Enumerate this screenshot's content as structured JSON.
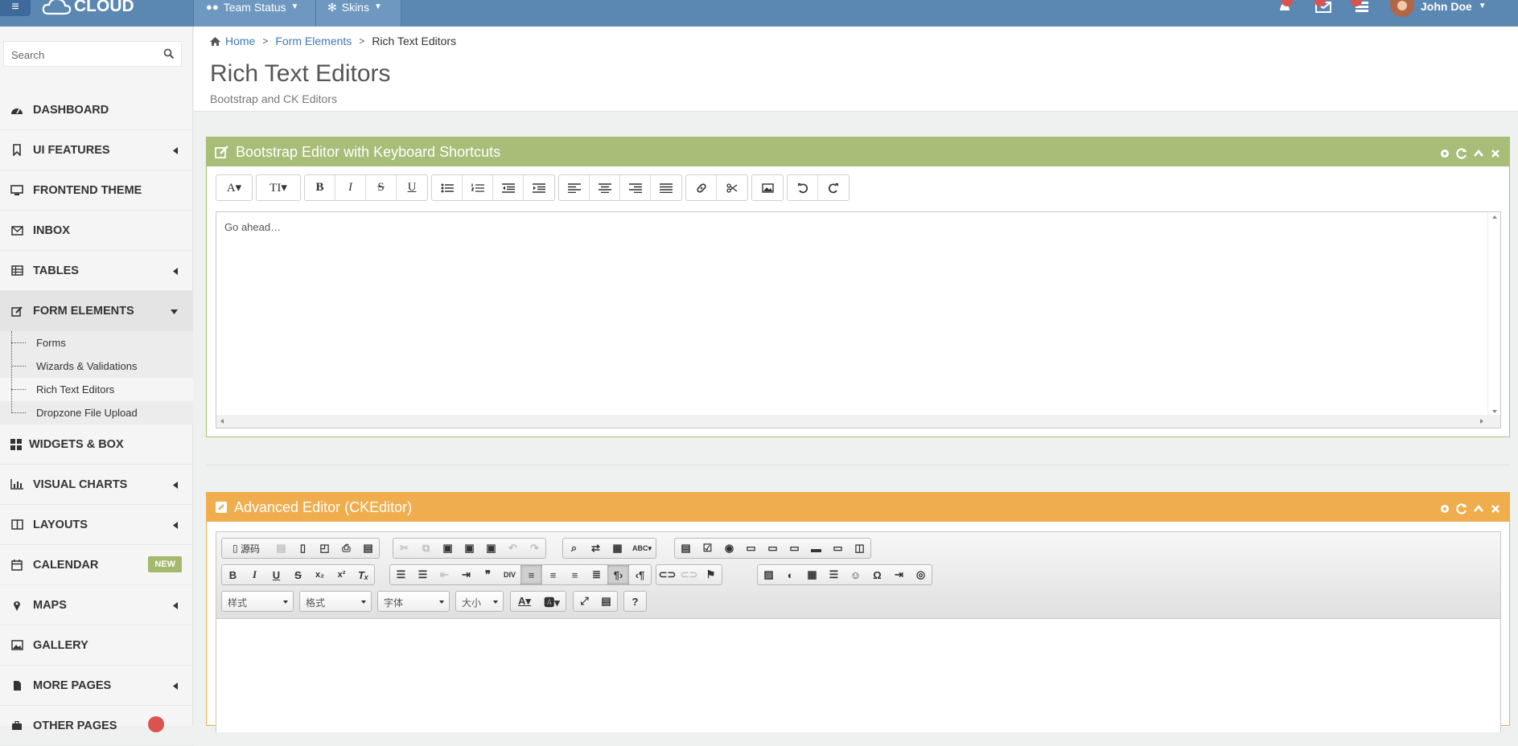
{
  "topbar": {
    "brand": "CLOUD",
    "nav": [
      "Team Status",
      "Skins"
    ],
    "user_name": "John Doe"
  },
  "sidebar": {
    "search_placeholder": "Search",
    "items": [
      {
        "label": "DASHBOARD",
        "icon": "dashboard-icon"
      },
      {
        "label": "UI FEATURES",
        "icon": "bookmark-icon"
      },
      {
        "label": "FRONTEND THEME",
        "icon": "desktop-icon"
      },
      {
        "label": "INBOX",
        "icon": "envelope-icon"
      },
      {
        "label": "TABLES",
        "icon": "table-icon"
      },
      {
        "label": "FORM ELEMENTS",
        "icon": "edit-icon"
      },
      {
        "label": "WIDGETS & BOX",
        "icon": "grid-icon"
      },
      {
        "label": "VISUAL CHARTS",
        "icon": "bar-chart-icon"
      },
      {
        "label": "LAYOUTS",
        "icon": "columns-icon"
      },
      {
        "label": "CALENDAR",
        "icon": "calendar-icon"
      },
      {
        "label": "MAPS",
        "icon": "map-marker-icon"
      },
      {
        "label": "GALLERY",
        "icon": "picture-icon"
      },
      {
        "label": "MORE PAGES",
        "icon": "file-icon"
      },
      {
        "label": "OTHER PAGES",
        "icon": "briefcase-icon"
      }
    ],
    "sub_items": [
      "Forms",
      "Wizards & Validations",
      "Rich Text Editors",
      "Dropzone File Upload"
    ],
    "calendar_badge": "NEW"
  },
  "header": {
    "breadcrumb": [
      "Home",
      "Form Elements",
      "Rich Text Editors"
    ],
    "title": "Rich Text Editors",
    "subtitle": "Bootstrap and CK Editors"
  },
  "box1": {
    "title": "Bootstrap Editor with Keyboard Shortcuts",
    "color": "#a7bd78",
    "editor_text": "Go ahead…"
  },
  "box2": {
    "title": "Advanced Editor (CKEditor)",
    "color": "#f0ad4e",
    "source_label": "源码",
    "selects": [
      "样式",
      "格式",
      "字体",
      "大小"
    ]
  }
}
